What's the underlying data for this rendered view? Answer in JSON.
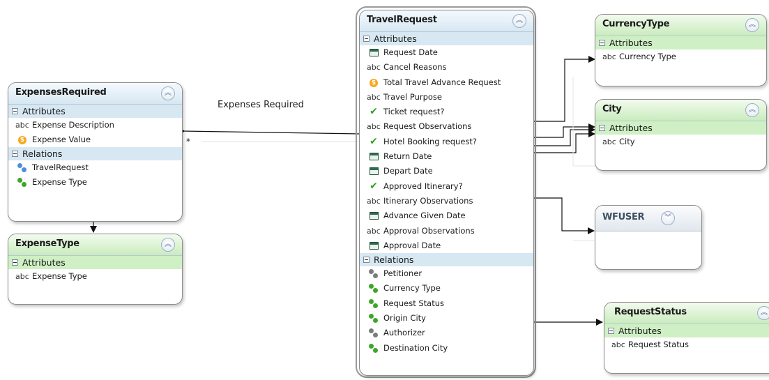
{
  "connector_labels": {
    "expenses_required": "Expenses Required",
    "star": "*"
  },
  "colors": {
    "blue_header": "#d6e7f3",
    "green_header": "#c9ecbd",
    "blue_section": "#d7e8f2",
    "green_section": "#cff0c5",
    "attr_check": "#2f9f21",
    "attr_coin": "#f6a81c",
    "rel_green": "#3ea629",
    "rel_gray": "#7b7b7b",
    "rel_blue": "#4a90d9"
  },
  "entities": {
    "travel_request": {
      "title": "TravelRequest",
      "attributes_label": "Attributes",
      "attributes": [
        {
          "icon": "date-icon",
          "label": "Request Date"
        },
        {
          "icon": "abc-icon",
          "label": "Cancel Reasons"
        },
        {
          "icon": "coin-icon",
          "label": "Total Travel Advance Request"
        },
        {
          "icon": "abc-icon",
          "label": "Travel Purpose"
        },
        {
          "icon": "check-icon",
          "label": "Ticket request?"
        },
        {
          "icon": "abc-icon",
          "label": "Request Observations"
        },
        {
          "icon": "check-icon",
          "label": "Hotel Booking request?"
        },
        {
          "icon": "date-icon",
          "label": "Return Date"
        },
        {
          "icon": "date-icon",
          "label": "Depart Date"
        },
        {
          "icon": "check-icon",
          "label": "Approved Itinerary?"
        },
        {
          "icon": "abc-icon",
          "label": "Itinerary Observations"
        },
        {
          "icon": "date-icon",
          "label": "Advance Given Date"
        },
        {
          "icon": "abc-icon",
          "label": "Approval Observations"
        },
        {
          "icon": "date-icon",
          "label": "Approval Date"
        }
      ],
      "relations_label": "Relations",
      "relations": [
        {
          "icon": "relation-gray-icon",
          "label": "Petitioner"
        },
        {
          "icon": "relation-green-icon",
          "label": "Currency Type"
        },
        {
          "icon": "relation-green-icon",
          "label": "Request Status"
        },
        {
          "icon": "relation-green-icon",
          "label": "Origin City"
        },
        {
          "icon": "relation-gray-icon",
          "label": "Authorizer"
        },
        {
          "icon": "relation-green-icon",
          "label": "Destination City"
        }
      ]
    },
    "expenses_required": {
      "title": "ExpensesRequired",
      "attributes_label": "Attributes",
      "attributes": [
        {
          "icon": "abc-icon",
          "label": "Expense Description"
        },
        {
          "icon": "coin-icon",
          "label": "Expense Value"
        }
      ],
      "relations_label": "Relations",
      "relations": [
        {
          "icon": "relation-blue-icon",
          "label": "TravelRequest"
        },
        {
          "icon": "relation-green-icon",
          "label": "Expense Type"
        }
      ]
    },
    "expense_type": {
      "title": "ExpenseType",
      "attributes_label": "Attributes",
      "attributes": [
        {
          "icon": "abc-icon",
          "label": "Expense Type"
        }
      ]
    },
    "currency_type": {
      "title": "CurrencyType",
      "attributes_label": "Attributes",
      "attributes": [
        {
          "icon": "abc-icon",
          "label": "Currency Type"
        }
      ]
    },
    "city": {
      "title": "City",
      "attributes_label": "Attributes",
      "attributes": [
        {
          "icon": "abc-icon",
          "label": "City"
        }
      ]
    },
    "wfuser": {
      "title": "WFUSER"
    },
    "request_status": {
      "title": "RequestStatus",
      "attributes_label": "Attributes",
      "attributes": [
        {
          "icon": "abc-icon",
          "label": "Request Status"
        }
      ]
    }
  },
  "glyphs": {
    "collapse": "︽",
    "expand": "︾",
    "abc": "abc",
    "coin": "$",
    "check": "✔"
  }
}
